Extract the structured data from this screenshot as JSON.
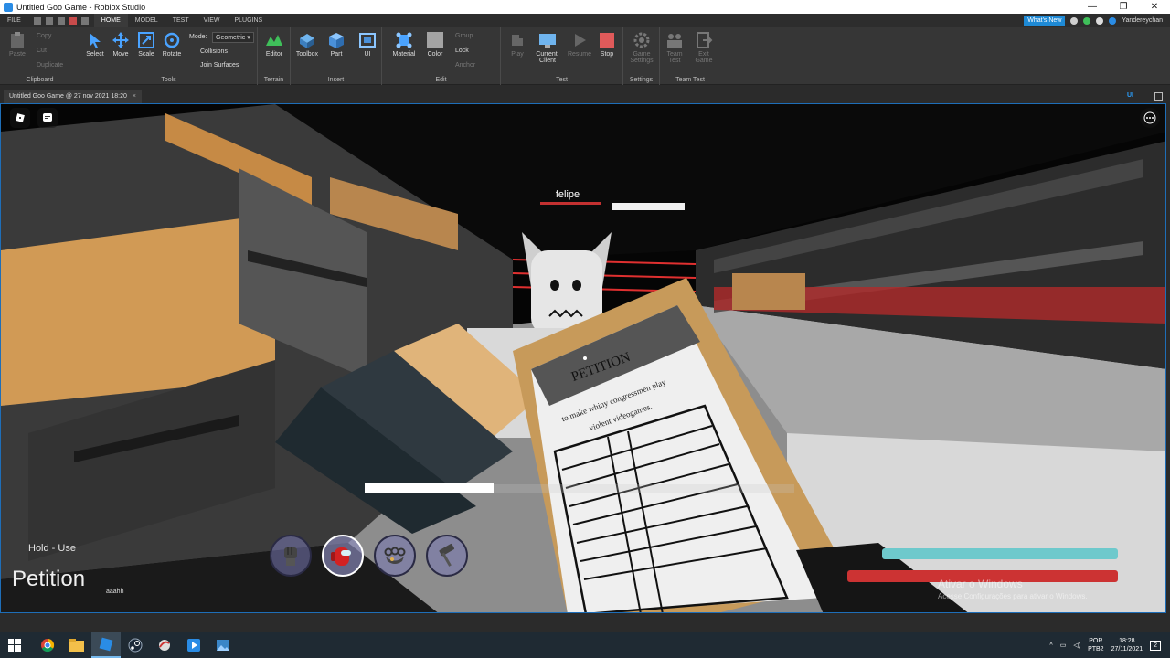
{
  "window": {
    "title": "Untitled Goo Game - Roblox Studio",
    "controls": [
      "—",
      "❐",
      "✕"
    ]
  },
  "menu": {
    "tabs": [
      "FILE",
      "HOME",
      "MODEL",
      "TEST",
      "VIEW",
      "PLUGINS"
    ],
    "active_tab": "HOME",
    "whats_new": "What's New",
    "username": "Yandereychan"
  },
  "ribbon": {
    "clipboard": {
      "label": "Clipboard",
      "paste": "Paste",
      "copy": "Copy",
      "cut": "Cut",
      "duplicate": "Duplicate"
    },
    "tools": {
      "label": "Tools",
      "select": "Select",
      "move": "Move",
      "scale": "Scale",
      "rotate": "Rotate",
      "mode_label": "Mode:",
      "mode_value": "Geometric",
      "collisions": "Collisions",
      "join_surfaces": "Join Surfaces"
    },
    "terrain": {
      "label": "Terrain",
      "editor": "Editor"
    },
    "insert": {
      "label": "Insert",
      "toolbox": "Toolbox",
      "part": "Part",
      "ui": "UI"
    },
    "edit": {
      "label": "Edit",
      "material": "Material",
      "color": "Color",
      "group": "Group",
      "lock": "Lock",
      "anchor": "Anchor"
    },
    "test": {
      "label": "Test",
      "play": "Play",
      "current_client": "Current:",
      "client": "Client",
      "resume": "Resume",
      "stop": "Stop"
    },
    "settings": {
      "label": "Settings",
      "game_settings_1": "Game",
      "game_settings_2": "Settings"
    },
    "team_test": {
      "label": "Team Test",
      "team_test_1": "Team",
      "team_test_2": "Test",
      "exit_game_1": "Exit",
      "exit_game_2": "Game"
    }
  },
  "document": {
    "tab": "Untitled Goo Game @ 27 nov 2021 18:20",
    "close": "×",
    "ui_toggle": "UI"
  },
  "game": {
    "player_name": "felipe",
    "petition_heading": "PETITION",
    "petition_line1": "to make whiny congressmen play",
    "petition_line2": "violent videogames.",
    "hold_hint": "Hold - Use",
    "item_title": "Petition",
    "item_subtitle": "aaahh",
    "hotbar": [
      "fist-item",
      "crewmate-item",
      "brass-knuckles-item",
      "hammer-item"
    ],
    "hotbar_active": 1,
    "use_progress": 0.3,
    "stamina": 0.87,
    "health": 1.0,
    "watermark_title": "Ativar o Windows",
    "watermark_text": "Acesse Configurações para ativar o Windows."
  },
  "taskbar": {
    "apps": [
      "windows-start",
      "chrome",
      "file-explorer",
      "roblox-studio",
      "steam",
      "app-5",
      "media-player",
      "photos"
    ],
    "active_app": 3,
    "lang_1": "POR",
    "lang_2": "PTB2",
    "time": "18:28",
    "date": "27/11/2021",
    "notifications": "2"
  },
  "colors": {
    "accent": "#1e8ad6",
    "health": "#cc3333",
    "stamina": "#6ec9cc",
    "viewport_border": "#1e6eb8"
  }
}
